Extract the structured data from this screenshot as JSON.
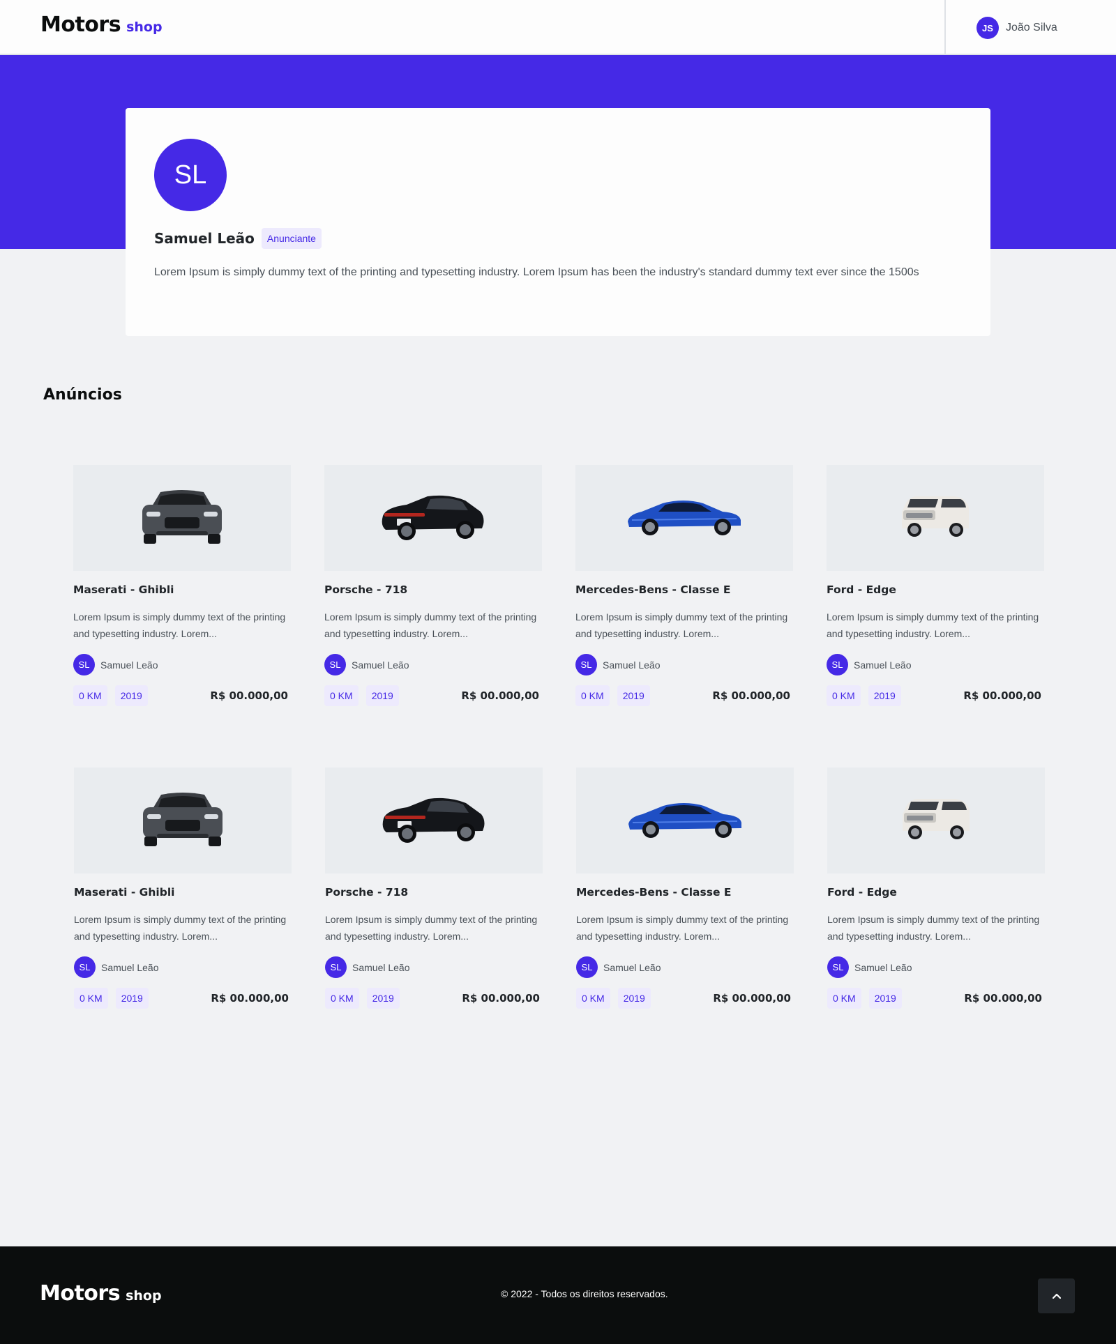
{
  "header": {
    "logo_main": "Motors",
    "logo_sub": "shop",
    "user_initials": "JS",
    "user_name": "João Silva"
  },
  "profile": {
    "initials": "SL",
    "name": "Samuel Leão",
    "role": "Anunciante",
    "description": "Lorem Ipsum is simply dummy text of the printing and typesetting industry. Lorem Ipsum has been the industry's standard dummy text ever since the 1500s"
  },
  "section_title": "Anúncios",
  "cards": [
    {
      "title": "Maserati - Ghibli",
      "desc": "Lorem Ipsum is simply dummy text of the printing and typesetting industry. Lorem...",
      "owner_initials": "SL",
      "owner": "Samuel Leão",
      "km": "0 KM",
      "year": "2019",
      "price": "R$ 00.000,00",
      "car": "gray-muscle-front"
    },
    {
      "title": "Porsche - 718",
      "desc": "Lorem Ipsum is simply dummy text of the printing and typesetting industry. Lorem...",
      "owner_initials": "SL",
      "owner": "Samuel Leão",
      "km": "0 KM",
      "year": "2019",
      "price": "R$ 00.000,00",
      "car": "black-sedan-rear"
    },
    {
      "title": "Mercedes-Bens - Classe E",
      "desc": "Lorem Ipsum is simply dummy text of the printing and typesetting industry. Lorem...",
      "owner_initials": "SL",
      "owner": "Samuel Leão",
      "km": "0 KM",
      "year": "2019",
      "price": "R$ 00.000,00",
      "car": "blue-coupe-side"
    },
    {
      "title": "Ford - Edge",
      "desc": "Lorem Ipsum is simply dummy text of the printing and typesetting industry. Lorem...",
      "owner_initials": "SL",
      "owner": "Samuel Leão",
      "km": "0 KM",
      "year": "2019",
      "price": "R$ 00.000,00",
      "car": "white-suv-front"
    },
    {
      "title": "Maserati - Ghibli",
      "desc": "Lorem Ipsum is simply dummy text of the printing and typesetting industry. Lorem...",
      "owner_initials": "SL",
      "owner": "Samuel Leão",
      "km": "0 KM",
      "year": "2019",
      "price": "R$ 00.000,00",
      "car": "gray-muscle-front"
    },
    {
      "title": "Porsche - 718",
      "desc": "Lorem Ipsum is simply dummy text of the printing and typesetting industry. Lorem...",
      "owner_initials": "SL",
      "owner": "Samuel Leão",
      "km": "0 KM",
      "year": "2019",
      "price": "R$ 00.000,00",
      "car": "black-sedan-rear"
    },
    {
      "title": "Mercedes-Bens - Classe E",
      "desc": "Lorem Ipsum is simply dummy text of the printing and typesetting industry. Lorem...",
      "owner_initials": "SL",
      "owner": "Samuel Leão",
      "km": "0 KM",
      "year": "2019",
      "price": "R$ 00.000,00",
      "car": "blue-coupe-side"
    },
    {
      "title": "Ford - Edge",
      "desc": "Lorem Ipsum is simply dummy text of the printing and typesetting industry. Lorem...",
      "owner_initials": "SL",
      "owner": "Samuel Leão",
      "km": "0 KM",
      "year": "2019",
      "price": "R$ 00.000,00",
      "car": "white-suv-front"
    }
  ],
  "footer": {
    "logo_main": "Motors",
    "logo_sub": "shop",
    "copyright": "© 2022 -  Todos os direitos reservados.",
    "scroll_icon": "chevron-up-icon"
  },
  "colors": {
    "brand": "#4529e6",
    "brand_light": "#edeafd",
    "page_bg": "#f1f2f4",
    "footer_bg": "#0b0d0d"
  }
}
